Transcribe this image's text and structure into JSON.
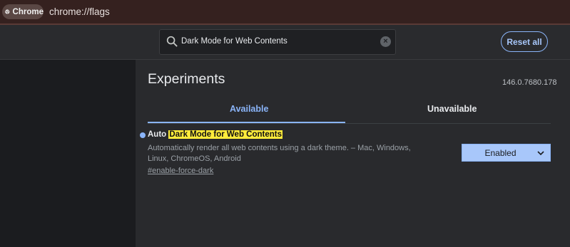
{
  "browser": {
    "chip_label": "Chrome",
    "url": "chrome://flags"
  },
  "header": {
    "search_value": "Dark Mode for Web Contents",
    "reset_label": "Reset all"
  },
  "main": {
    "title": "Experiments",
    "version": "146.0.7680.178",
    "tabs": [
      {
        "label": "Available",
        "selected": true
      },
      {
        "label": "Unavailable",
        "selected": false
      }
    ]
  },
  "flag": {
    "prefix": "Auto",
    "name_highlight": "Dark Mode for Web Contents",
    "description": "Automatically render all web contents using a dark theme. – Mac, Windows, Linux, ChromeOS, Android",
    "anchor": "#enable-force-dark",
    "select_value": "Enabled"
  },
  "colors": {
    "accent": "#8ab4f8",
    "highlight": "#ffeb3b",
    "addressbar": "#35211f"
  },
  "icons": [
    "chrome-logo-icon",
    "search-icon",
    "clear-icon",
    "chevron-down-icon"
  ]
}
